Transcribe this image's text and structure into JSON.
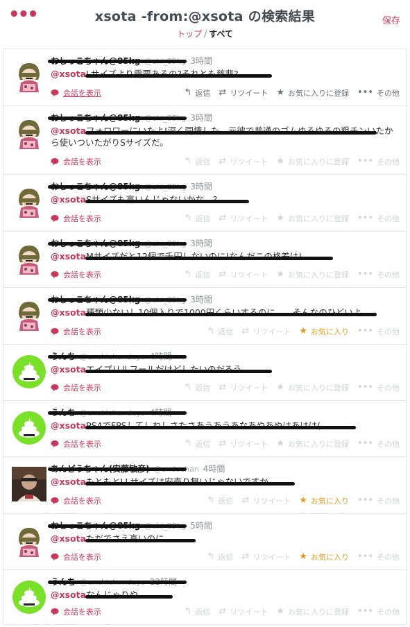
{
  "header": {
    "title": "xsota -from:@xsota の検索結果",
    "save_label": "保存",
    "breadcrumb_top": "トップ",
    "breadcrumb_sep": "/",
    "breadcrumb_all": "すべて"
  },
  "labels": {
    "show_conversation": "会話を表示",
    "reply": "返信",
    "retweet": "リツイート",
    "favorite_add": "お気に入りに登録",
    "favorite_on": "お気に入り",
    "more": "その他"
  },
  "icons": {
    "menu": "menu-dots-icon",
    "reply": "reply-icon",
    "retweet": "retweet-icon",
    "star": "star-icon",
    "more": "more-dots-icon",
    "conversation": "speech-bubble-icon"
  },
  "colors": {
    "accent": "#c8385a",
    "favorited": "#e39a1c",
    "avatar_green": "#7be02a"
  },
  "tweets": [
    {
      "user": "おしっこちゃん@85kg",
      "handle": "@chi_85kg",
      "time": "3時間",
      "mention": "@xsota",
      "text": "Lサイズより需要あるの?それとも慈悲?",
      "avatar": "anime",
      "faded": false,
      "favorited": false
    },
    {
      "user": "おしっこちゃん@85kg",
      "handle": "@chi_85kg",
      "time": "3時間",
      "mention": "@xsota",
      "text": "フォロワーにいたよ!深く同情した。元彼で普通のゴムゆるゆるの粗チンいたから使いついたがりSサイズだ。",
      "avatar": "anime",
      "faded": true,
      "favorited": false
    },
    {
      "user": "おしっこちゃん@85kg",
      "handle": "@chi_85kg",
      "time": "3時間",
      "mention": "@xsota",
      "text": "Sサイズも高いんじゃないかな…?",
      "avatar": "anime",
      "faded": true,
      "favorited": false
    },
    {
      "user": "おしっこちゃん@85kg",
      "handle": "@chi_85kg",
      "time": "3時間",
      "mention": "@xsota",
      "text": "Mサイズだと12個で千円しないのに!なんだこの格差は!",
      "avatar": "anime",
      "faded": true,
      "favorited": false
    },
    {
      "user": "おしっこちゃん@85kg",
      "handle": "@chi_85kg",
      "time": "3時間",
      "mention": "@xsota",
      "text": "種類少ないし10個入りで1000円くらいするのに……そんなのひどいよ",
      "avatar": "anime",
      "faded": true,
      "favorited": true
    },
    {
      "user": "うんち",
      "handle": "@unchichandayo",
      "time": "4時間",
      "mention": "@xsota",
      "text": "エイプリルフールだけどしたいのだろう。",
      "avatar": "poop",
      "faded": true,
      "favorited": false
    },
    {
      "user": "うんち",
      "handle": "@unchichandayo",
      "time": "4時間",
      "mention": "@xsota",
      "text": "PS4でFPSしてしねしさたさあうあうあなあやあやはあはは(",
      "avatar": "poop",
      "faded": true,
      "favorited": false
    },
    {
      "user": "あんどうちゃん(安藤敏彦)",
      "handle": "@andochan",
      "time": "4時間",
      "mention": "@xsota",
      "text": "もともとLLサイズは安売り無いじゃないですか",
      "avatar": "photo",
      "faded": true,
      "favorited": true
    },
    {
      "user": "おしっこちゃん@85kg",
      "handle": "@chi_85kg",
      "time": "5時間",
      "mention": "@xsota",
      "text": "ただでさえ高いのに",
      "avatar": "anime",
      "faded": true,
      "favorited": true
    },
    {
      "user": "うんち",
      "handle": "@unchichandayo",
      "time": "22時間",
      "mention": "@xsota",
      "text": "なんじゃりや",
      "avatar": "poop",
      "faded": true,
      "favorited": false
    }
  ]
}
